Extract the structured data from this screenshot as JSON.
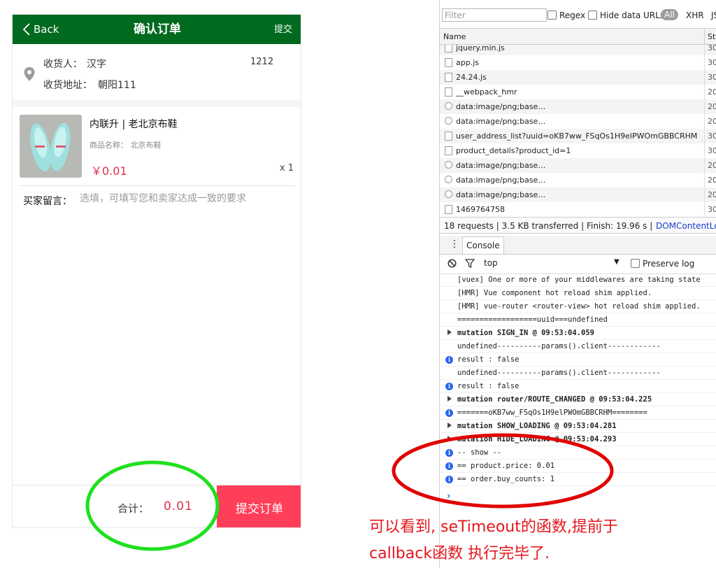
{
  "app": {
    "header": {
      "back_label": "Back",
      "title": "确认订单",
      "submit_label": "提交"
    },
    "address": {
      "receiver_label": "收货人：",
      "receiver_name": "汉字",
      "receiver_phone": "1212",
      "address_label": "收货地址：",
      "address_value": "朝阳111"
    },
    "product": {
      "title": "内联升 | 老北京布鞋",
      "name_label": "商品名称：  北京布鞋",
      "price": "￥0.01",
      "quantity": "x  1"
    },
    "message": {
      "label": "买家留言：",
      "placeholder": "选填，可填写您和卖家达成一致的要求"
    },
    "footer": {
      "total_label": "合计：",
      "total_value": "0.01",
      "submit_label": "提交订单"
    }
  },
  "devtools": {
    "filter_placeholder": "Filter",
    "regex_label": "Regex",
    "hide_urls_label": "Hide data URLs",
    "all_label": "All",
    "xhr_label": "XHR",
    "js_label": "JS",
    "name_column": "Name",
    "status_column": "Sta",
    "requests": [
      {
        "name": "jquery.min.js",
        "status": "30",
        "icon": "file"
      },
      {
        "name": "app.js",
        "status": "30",
        "icon": "file"
      },
      {
        "name": "24.24.js",
        "status": "30",
        "icon": "file"
      },
      {
        "name": "__webpack_hmr",
        "status": "20",
        "icon": "file"
      },
      {
        "name": "data:image/png;base…",
        "status": "20",
        "icon": "image"
      },
      {
        "name": "data:image/png;base…",
        "status": "20",
        "icon": "image"
      },
      {
        "name": "user_address_list?uuid=oKB7ww_FSqOs1H9elPWOmGBBCRHM",
        "status": "30",
        "icon": "file"
      },
      {
        "name": "product_details?product_id=1",
        "status": "30",
        "icon": "file"
      },
      {
        "name": "data:image/png;base…",
        "status": "20",
        "icon": "image"
      },
      {
        "name": "data:image/png;base…",
        "status": "20",
        "icon": "image"
      },
      {
        "name": "data:image/png;base…",
        "status": "20",
        "icon": "image"
      },
      {
        "name": "1469764758",
        "status": "30",
        "icon": "file"
      }
    ],
    "summary": "18 requests  |  3.5 KB transferred  |  Finish: 19.96 s  |",
    "dom_content_loaded": "DOMContentLo",
    "console_tab": "Console",
    "context": "top",
    "preserve_log_label": "Preserve log",
    "logs": [
      {
        "text": "[vuex] One or more of your middlewares are taking state",
        "kind": "plain"
      },
      {
        "text": "[HMR] Vue component hot reload shim applied.",
        "kind": "plain"
      },
      {
        "text": "[HMR] vue-router <router-view> hot reload shim applied.",
        "kind": "plain"
      },
      {
        "text": "==================uuid===undefined",
        "kind": "plain"
      },
      {
        "text": "mutation SIGN_IN @ 09:53:04.059",
        "kind": "group"
      },
      {
        "text": "undefined----------params().client------------",
        "kind": "plain"
      },
      {
        "text": " result : false",
        "kind": "info"
      },
      {
        "text": "undefined----------params().client------------",
        "kind": "plain"
      },
      {
        "text": " result : false",
        "kind": "info"
      },
      {
        "text": "mutation router/ROUTE_CHANGED @ 09:53:04.225",
        "kind": "group"
      },
      {
        "text": "=======oKB7ww_FSqOs1H9elPWOmGBBCRHM========",
        "kind": "info"
      },
      {
        "text": "mutation SHOW_LOADING @ 09:53:04.281",
        "kind": "group"
      },
      {
        "text": "mutation HIDE_LOADING @ 09:53:04.293",
        "kind": "group"
      },
      {
        "text": "-- show --",
        "kind": "info"
      },
      {
        "text": "== product.price: 0.01",
        "kind": "info"
      },
      {
        "text": "== order.buy_counts: 1",
        "kind": "info"
      }
    ],
    "prompt": "›"
  },
  "annotation": {
    "line1": "可以看到, seTimeout的函数,提前于",
    "line2": "callback函数 执行完毕了."
  },
  "colors": {
    "header_green": "#006a1f",
    "price_red": "#e0304a",
    "submit_red": "#ff3f5a",
    "annotation_red": "#e3161c",
    "green_circle": "#1fe01f",
    "red_circle": "#e00000"
  }
}
